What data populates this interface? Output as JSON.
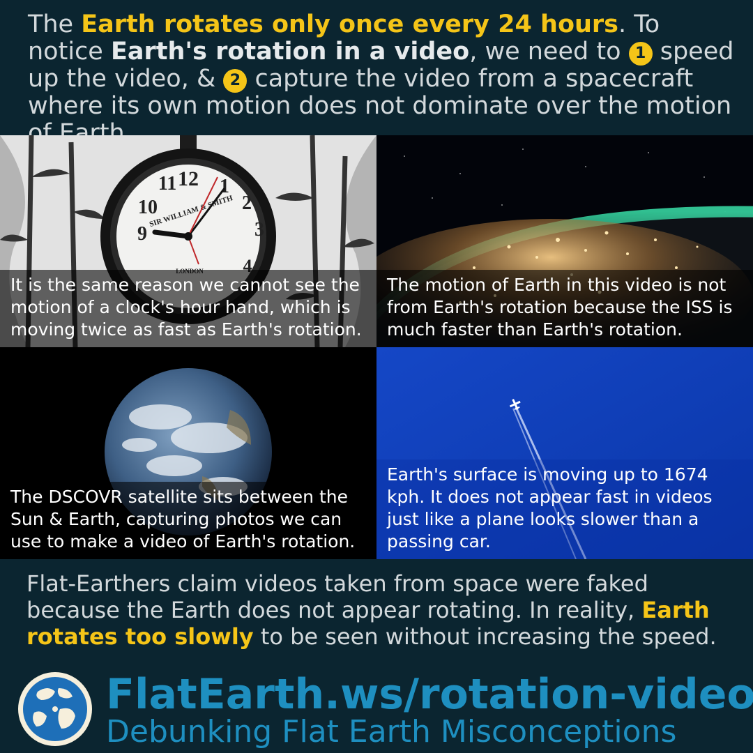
{
  "intro": {
    "t1": "The ",
    "h1": "Earth rotates only once every 24 hours",
    "t2": ". To notice ",
    "b1": "Earth's rotation in a video",
    "t3": ", we need to ",
    "n1": "1",
    "t4": " speed up the video, & ",
    "n2": "2",
    "t5": " capture the video from a spacecraft where its own motion does not dominate over the motion of Earth."
  },
  "panels": [
    {
      "caption": "It is the same reason we cannot see the motion of a clock's hour hand, which is moving twice as fast as Earth's rotation.",
      "clock": {
        "n12": "12",
        "n11": "11",
        "n1": "1",
        "n10": "10",
        "n2": "2",
        "n9": "9",
        "n3": "3",
        "n4": "4",
        "brand": "SIR WILLIAM & SMITH",
        "city": "LONDON"
      }
    },
    {
      "caption": "The motion of Earth in this video is not from Earth's rotation because the ISS is much faster than Earth's rotation."
    },
    {
      "caption": "The DSCOVR satellite sits between the Sun & Earth, capturing photos we can use to make a video of Earth's rotation."
    },
    {
      "caption": "Earth's surface is moving up to 1674 kph. It does not appear fast in videos just like a plane looks slower than a passing car."
    }
  ],
  "outro": {
    "t1": "Flat-Earthers claim videos taken from space were faked because the Earth does not appear rotating. In reality, ",
    "h1": "Earth rotates too slowly",
    "t2": " to be seen without increasing the speed."
  },
  "footer": {
    "site": "FlatEarth.ws/rotation-video",
    "tagline": "Debunking Flat Earth Misconceptions"
  },
  "colors": {
    "background": "#0b2530",
    "highlight": "#f5c518",
    "brand": "#1e8fc0"
  }
}
